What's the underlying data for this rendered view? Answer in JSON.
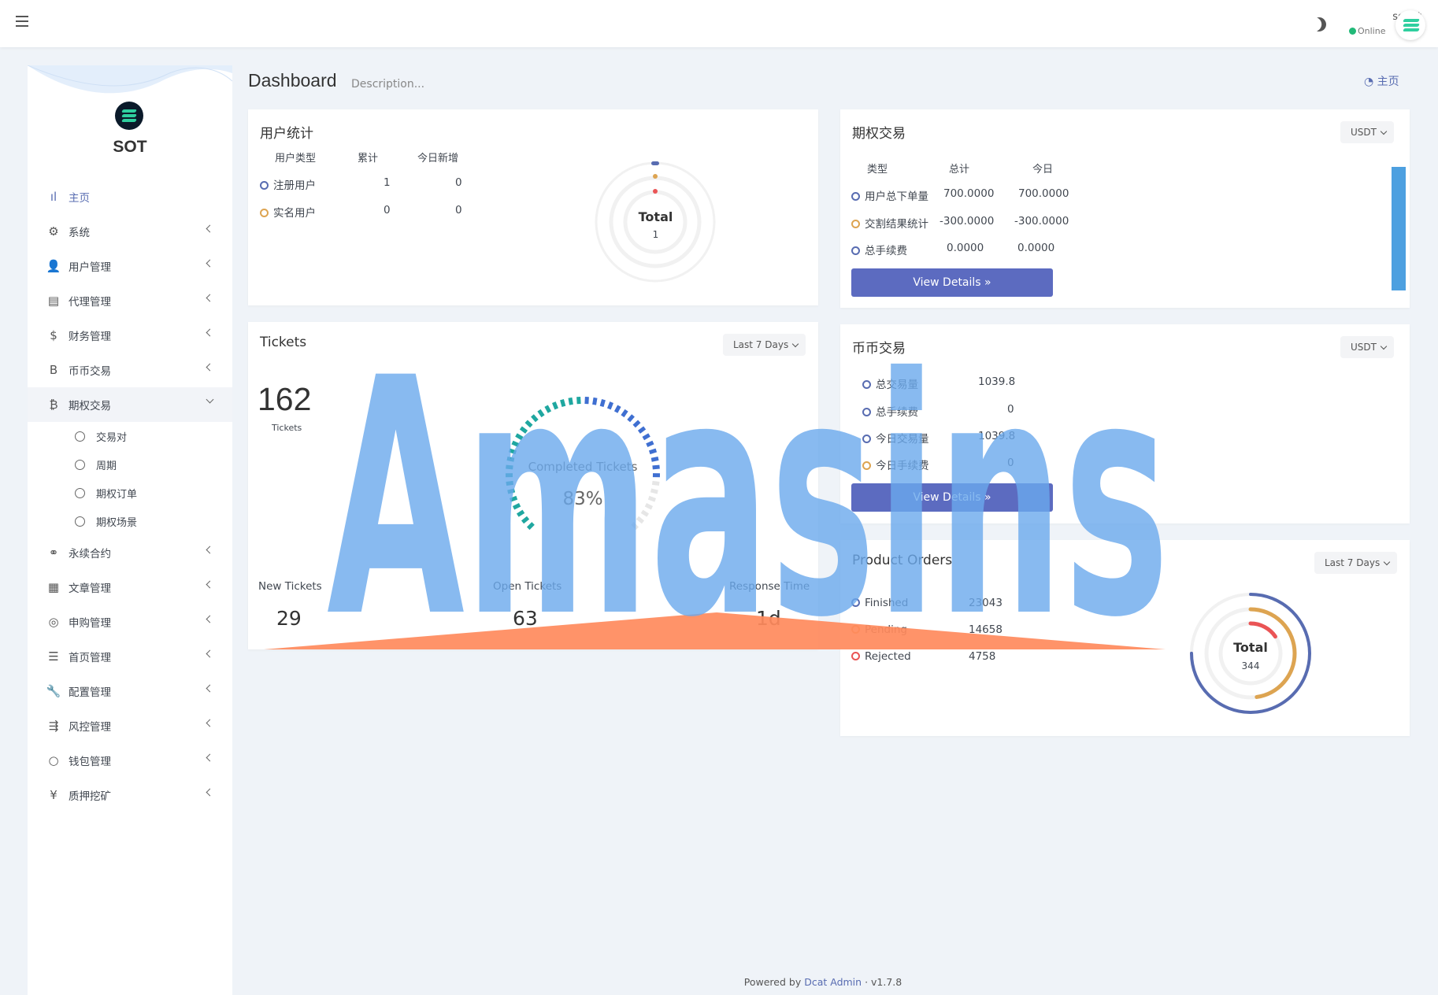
{
  "topbar": {
    "user_name": "sotbit",
    "user_status": "Online"
  },
  "sidebar": {
    "logo": "SOT",
    "items": [
      {
        "label": "主页",
        "icon": "bar-chart-icon",
        "glyph": "ıl",
        "active": true
      },
      {
        "label": "系统",
        "icon": "gear-icon",
        "glyph": "⚙"
      },
      {
        "label": "用户管理",
        "icon": "user-tie-icon",
        "glyph": "👤"
      },
      {
        "label": "代理管理",
        "icon": "id-card-icon",
        "glyph": "▤"
      },
      {
        "label": "财务管理",
        "icon": "dollar-icon",
        "glyph": "$"
      },
      {
        "label": "币币交易",
        "icon": "bold-b-icon",
        "glyph": "B"
      },
      {
        "label": "期权交易",
        "icon": "bitcoin-icon",
        "glyph": "₿",
        "open": true
      }
    ],
    "sub_items": [
      "交易对",
      "周期",
      "期权订单",
      "期权场景"
    ],
    "items_after": [
      {
        "label": "永续合约",
        "icon": "link-icon",
        "glyph": "⚭"
      },
      {
        "label": "文章管理",
        "icon": "newspaper-icon",
        "glyph": "▦"
      },
      {
        "label": "申购管理",
        "icon": "life-ring-icon",
        "glyph": "◎"
      },
      {
        "label": "首页管理",
        "icon": "list-icon",
        "glyph": "☰"
      },
      {
        "label": "配置管理",
        "icon": "wrench-icon",
        "glyph": "🔧"
      },
      {
        "label": "风控管理",
        "icon": "indent-icon",
        "glyph": "⇶"
      },
      {
        "label": "钱包管理",
        "icon": "circle-icon",
        "glyph": "○"
      },
      {
        "label": "质押挖矿",
        "icon": "yen-icon",
        "glyph": "¥"
      }
    ]
  },
  "header": {
    "title": "Dashboard",
    "description": "Description...",
    "breadcrumb": "主页"
  },
  "user_stats": {
    "title": "用户统计",
    "columns": [
      "用户类型",
      "累计",
      "今日新增"
    ],
    "rows": [
      {
        "label": "注册用户",
        "total": "1",
        "today": "0",
        "color": "#586cb1"
      },
      {
        "label": "实名用户",
        "total": "0",
        "today": "0",
        "color": "#dda451"
      }
    ],
    "donut_label": "Total",
    "donut_value": "1"
  },
  "options_trade": {
    "title": "期权交易",
    "currency": "USDT",
    "columns": [
      "类型",
      "总计",
      "今日"
    ],
    "rows": [
      {
        "label": "用户总下单量",
        "total": "700.0000",
        "today": "700.0000"
      },
      {
        "label": "交割结果统计",
        "total": "-300.0000",
        "today": "-300.0000"
      },
      {
        "label": "总手续费",
        "total": "0.0000",
        "today": "0.0000"
      }
    ],
    "button": "View Details »"
  },
  "tickets": {
    "title": "Tickets",
    "range": "Last 7 Days",
    "count": "162",
    "count_label": "Tickets",
    "completed_label": "Completed Tickets",
    "completed_value": "83%",
    "completed_fraction": 0.83,
    "stats": [
      {
        "label": "New Tickets",
        "value": "29"
      },
      {
        "label": "Open Tickets",
        "value": "63"
      },
      {
        "label": "Response Time",
        "value": "1d"
      }
    ]
  },
  "spot_trade": {
    "title": "币币交易",
    "currency": "USDT",
    "rows": [
      {
        "label": "总交易量",
        "value": "1039.8"
      },
      {
        "label": "总手续费",
        "value": "0"
      },
      {
        "label": "今日交易量",
        "value": "1039.8"
      },
      {
        "label": "今日手续费",
        "value": "0"
      }
    ],
    "button": "View Details »"
  },
  "product_orders": {
    "title": "Product Orders",
    "range": "Last 7 Days",
    "rows": [
      {
        "label": "Finished",
        "value": "23043",
        "color": "#586cb1"
      },
      {
        "label": "Pending",
        "value": "14658",
        "color": "#dda451"
      },
      {
        "label": "Rejected",
        "value": "4758",
        "color": "#ea5455"
      }
    ],
    "donut_label": "Total",
    "donut_value": "344"
  },
  "watermark": "Amasins",
  "footer": {
    "prefix": "Powered by",
    "link": "Dcat Admin",
    "version": "v1.7.8"
  }
}
